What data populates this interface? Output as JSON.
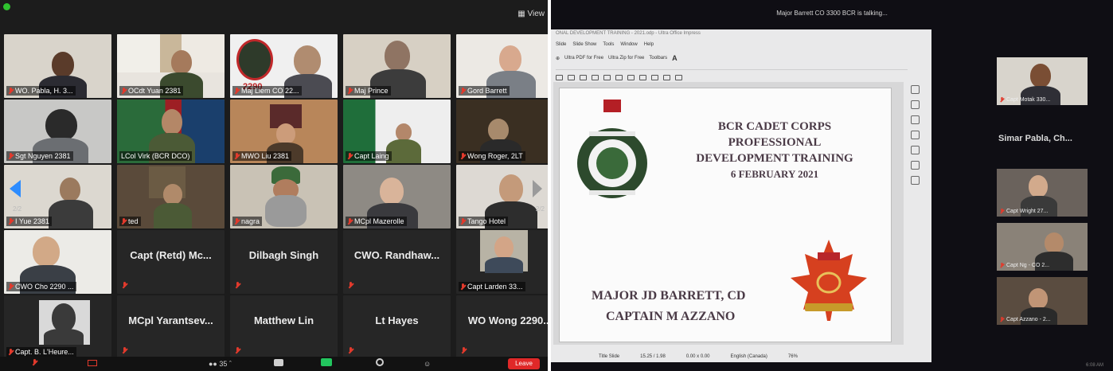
{
  "gallery": {
    "view_label": "View",
    "page_indicator_left": "2/2",
    "page_indicator_right": "2/2",
    "tiles": [
      {
        "name": "WO. Pabla, H. 3..."
      },
      {
        "name": "OCdt Yuan 2381"
      },
      {
        "name": "Maj Liem CO 22..."
      },
      {
        "name": "Maj Prince"
      },
      {
        "name": "Gord Barrett"
      },
      {
        "name": "Sgt Nguyen 2381"
      },
      {
        "name": "LCol Virk (BCR DCO)"
      },
      {
        "name": "MWO Liu 2381"
      },
      {
        "name": "Capt Laing"
      },
      {
        "name": "Wong Roger, 2LT"
      },
      {
        "name": "I Yue 2381"
      },
      {
        "name": "ted"
      },
      {
        "name": "nagra"
      },
      {
        "name": "MCpl Mazerolle"
      },
      {
        "name": "Tango Hotel"
      },
      {
        "name": "CWO Cho 2290 ..."
      },
      {
        "name": "Capt (Retd) Mc..."
      },
      {
        "name": "Dilbagh Singh"
      },
      {
        "name": "CWO. Randhaw..."
      },
      {
        "name": "Capt Larden 33..."
      },
      {
        "name": "Capt. B. L'Heure..."
      },
      {
        "name": "MCpl Yarantsev..."
      },
      {
        "name": "Matthew Lin"
      },
      {
        "name": "Lt Hayes"
      },
      {
        "name": "WO Wong 2290..."
      }
    ],
    "crest_number": "2290",
    "participants_count": "35",
    "leave_label": "Leave"
  },
  "share": {
    "talking_banner": "Major Barrett CO 3300 BCR is talking...",
    "window_title": "ONAL DEVELOPMENT TRAINING - 2021.odp - Ultra Office Impress",
    "menu": [
      "Slide",
      "Slide Show",
      "Tools",
      "Window",
      "Help"
    ],
    "toolbar_items": [
      "Ultra PDF for Free",
      "Ultra Zip for Free",
      "Toolbars"
    ],
    "slide": {
      "title_lines": [
        "BCR CADET CORPS",
        "PROFESSIONAL",
        "DEVELOPMENT TRAINING",
        "6 FEBRUARY 2021"
      ],
      "signatures": [
        "MAJOR JD BARRETT, CD",
        "CAPTAIN M AZZANO"
      ]
    },
    "status": {
      "view": "Title Slide",
      "position": "15.25 / 1.98",
      "size": "0.00 x 0.00",
      "language": "English (Canada)",
      "zoom": "76%"
    },
    "strip": [
      {
        "name": "Capt Motak 330..."
      },
      {
        "name": "Capt Wright 27..."
      },
      {
        "name": "Capt Ng - CO 2..."
      },
      {
        "name": "Capt Azzano - 2..."
      }
    ],
    "strip_label": "Simar Pabla, Ch...",
    "clock": "6:08 AM"
  }
}
